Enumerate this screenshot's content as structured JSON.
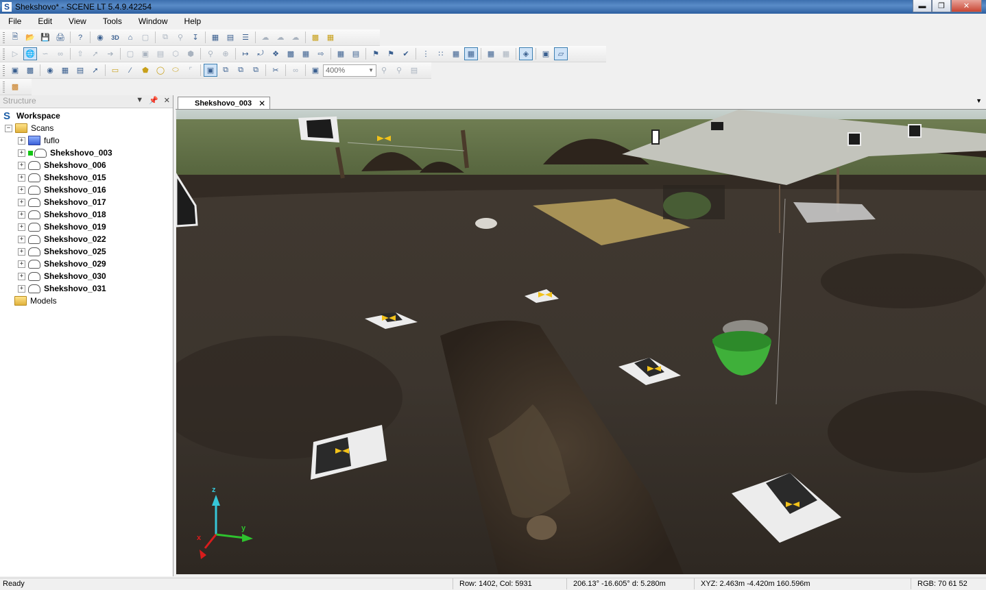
{
  "window": {
    "title": "Shekshovo* - SCENE LT 5.4.9.42254",
    "app_icon_letter": "S"
  },
  "window_buttons": [
    "minimize",
    "maximize",
    "close"
  ],
  "menu": [
    "File",
    "Edit",
    "View",
    "Tools",
    "Window",
    "Help"
  ],
  "toolbar": {
    "zoom_value": "400%"
  },
  "structure": {
    "panel_title": "Structure",
    "workspace_label": "Workspace",
    "scans_label": "Scans",
    "scan_items": [
      "fuflo",
      "Shekshovo_003",
      "Shekshovo_006",
      "Shekshovo_015",
      "Shekshovo_016",
      "Shekshovo_017",
      "Shekshovo_018",
      "Shekshovo_019",
      "Shekshovo_022",
      "Shekshovo_025",
      "Shekshovo_029",
      "Shekshovo_030",
      "Shekshovo_031"
    ],
    "models_label": "Models"
  },
  "document": {
    "tab_label": "Shekshovo_003",
    "close_glyph": "✕"
  },
  "axes": {
    "z": "z",
    "y": "y",
    "x": "x"
  },
  "statusbar": {
    "ready": "Ready",
    "rowcol": "Row: 1402, Col: 5931",
    "angles": "206.13° -16.605°  d: 5.280m",
    "xyz": "XYZ: 2.463m -4.420m 160.596m",
    "rgb": "RGB: 70 61 52"
  },
  "colors": {
    "titlebar": "#3c6fae",
    "axis_z": "#36c6d8",
    "axis_y": "#2ec22e",
    "axis_x": "#d81c1c",
    "scan_marker": "#f2c21a"
  }
}
